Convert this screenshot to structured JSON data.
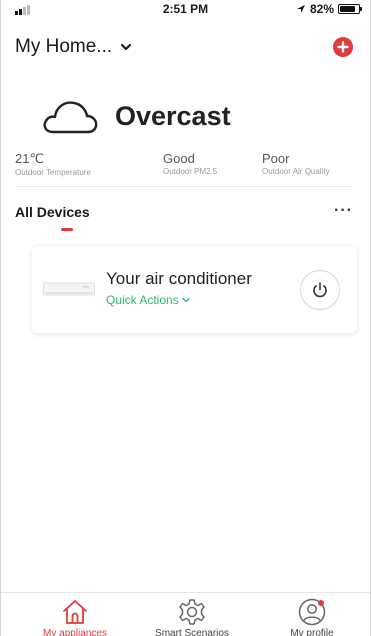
{
  "status_bar": {
    "time": "2:51 PM",
    "battery": "82%"
  },
  "header": {
    "home_label": "My Home...",
    "add_icon": "plus-circle-icon"
  },
  "weather": {
    "condition": "Overcast",
    "stats": [
      {
        "value": "21℃",
        "label": "Outdoor Temperature"
      },
      {
        "value": "Good",
        "label": "Outdoor PM2.5"
      },
      {
        "value": "Poor",
        "label": "Outdoor Air Quality"
      }
    ]
  },
  "devices": {
    "title": "All Devices",
    "more": "···",
    "items": [
      {
        "name": "Your air conditioner",
        "quick_actions_label": "Quick Actions",
        "power_icon": "power-icon"
      }
    ]
  },
  "nav": {
    "items": [
      {
        "label": "My appliances",
        "icon": "home-icon",
        "active": true
      },
      {
        "label": "Smart Scenarios",
        "icon": "gear-icon",
        "active": false
      },
      {
        "label": "My profile",
        "icon": "profile-icon",
        "active": false
      }
    ]
  },
  "colors": {
    "accent": "#e03a3a",
    "green": "#2bb673"
  }
}
